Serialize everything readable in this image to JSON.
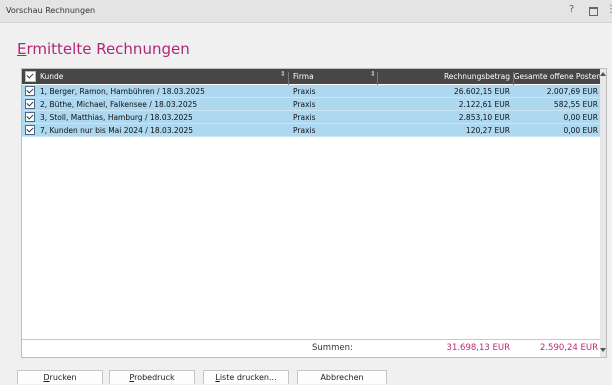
{
  "window": {
    "title": "Vorschau Rechnungen",
    "help": "?"
  },
  "heading": {
    "first_letter": "E",
    "rest": "rmittelte Rechnungen"
  },
  "table": {
    "columns": {
      "kunde": "Kunde",
      "firma": "Firma",
      "betrag": "Rechnungsbetrag",
      "posten": "Gesamte offene Posten"
    },
    "rows": [
      {
        "checked": true,
        "kunde": "1, Berger, Ramon, Hambühren / 18.03.2025",
        "firma": "Praxis",
        "betrag": "26.602,15 EUR",
        "posten": "2.007,69 EUR"
      },
      {
        "checked": true,
        "kunde": "2, Büthe, Michael, Falkensee / 18.03.2025",
        "firma": "Praxis",
        "betrag": "2.122,61 EUR",
        "posten": "582,55 EUR"
      },
      {
        "checked": true,
        "kunde": "3, Stoll, Matthias, Hamburg / 18.03.2025",
        "firma": "Praxis",
        "betrag": "2.853,10 EUR",
        "posten": "0,00 EUR"
      },
      {
        "checked": true,
        "kunde": "7, Kunden nur bis Mai 2024 / 18.03.2025",
        "firma": "Praxis",
        "betrag": "120,27 EUR",
        "posten": "0,00 EUR"
      }
    ],
    "summen": {
      "label": "Summen:",
      "betrag": "31.698,13 EUR",
      "posten": "2.590,24 EUR"
    }
  },
  "buttons": {
    "drucken": {
      "mn": "D",
      "rest": "rucken"
    },
    "probedruck": {
      "mn": "P",
      "rest": "robedruck"
    },
    "liste": {
      "mn": "L",
      "rest": "iste drucken..."
    },
    "abbrechen": {
      "label": "Abbrechen"
    }
  },
  "colors": {
    "accent": "#b0267a",
    "selected_row": "#add8f0",
    "header_bg": "#474747"
  }
}
